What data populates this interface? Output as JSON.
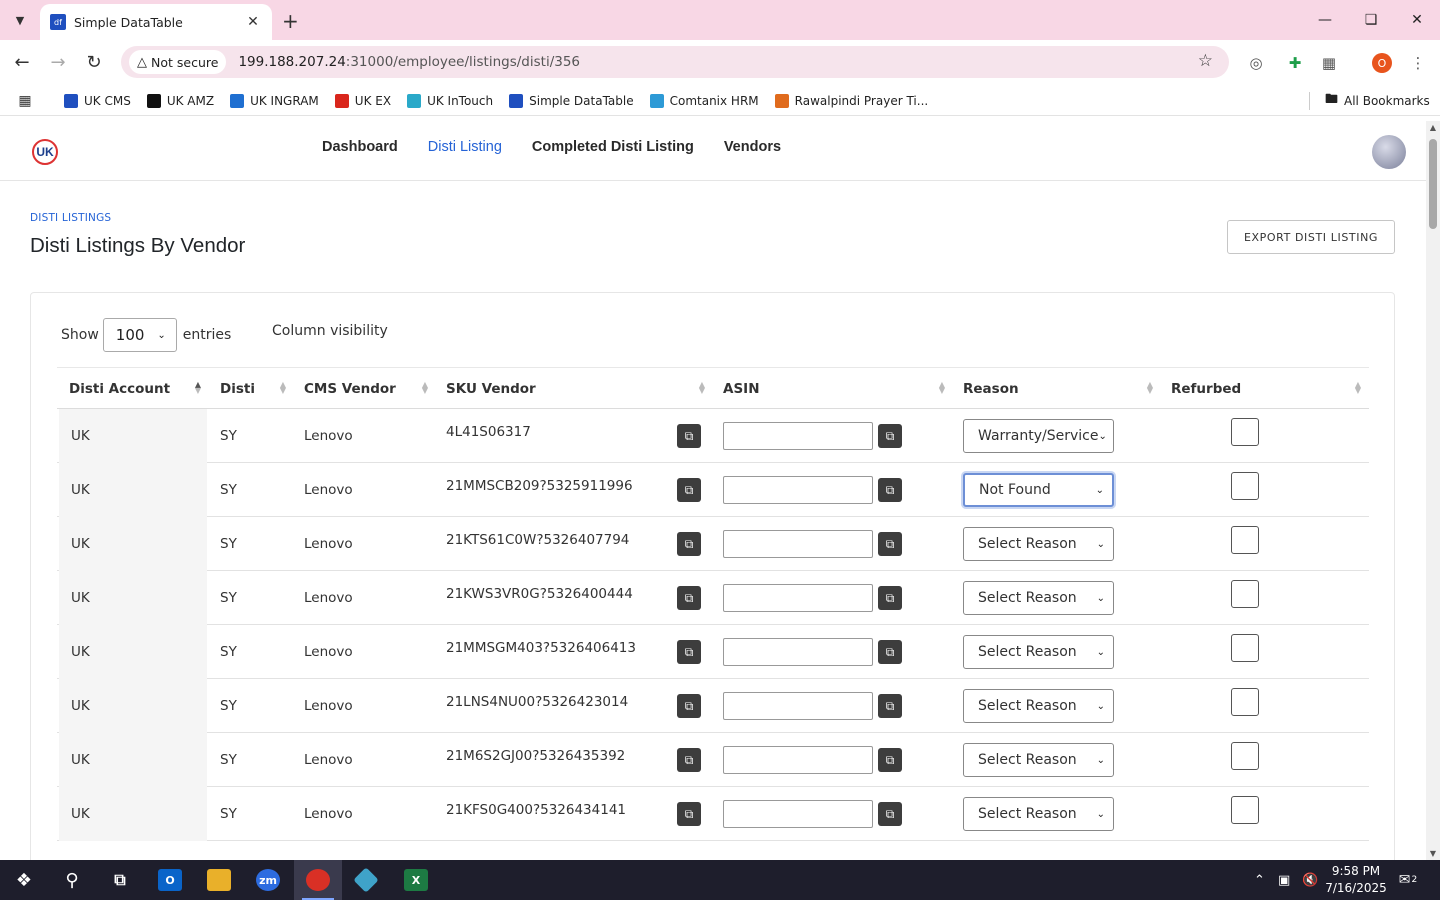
{
  "browser": {
    "tab_title": "Simple DataTable",
    "tab_favicon_text": "df",
    "security_label": "Not secure",
    "url_host": "199.188.207.24",
    "url_rest": ":31000/employee/listings/disti/356",
    "profile_initial": "O",
    "bookmarks": [
      {
        "label": "UK CMS",
        "color": "#1f4fbf"
      },
      {
        "label": "UK AMZ",
        "color": "#111111"
      },
      {
        "label": "UK INGRAM",
        "color": "#1f6fd1"
      },
      {
        "label": "UK EX",
        "color": "#d9261c"
      },
      {
        "label": "UK InTouch",
        "color": "#2aa9c9"
      },
      {
        "label": "Simple DataTable",
        "color": "#1f4fbf"
      },
      {
        "label": "Comtanix HRM",
        "color": "#2d9ad6"
      },
      {
        "label": "Rawalpindi Prayer Ti...",
        "color": "#e06b1d"
      }
    ],
    "all_bookmarks": "All Bookmarks"
  },
  "app": {
    "logo_text": "UK",
    "nav": [
      "Dashboard",
      "Disti Listing",
      "Completed Disti Listing",
      "Vendors"
    ],
    "active_nav": "Disti Listing"
  },
  "page": {
    "overline": "DISTI LISTINGS",
    "title": "Disti Listings By Vendor",
    "export_label": "EXPORT DISTI LISTING",
    "show_label": "Show",
    "entries_value": "100",
    "entries_label": "entries",
    "column_visibility": "Column visibility"
  },
  "table": {
    "headers": [
      "Disti Account",
      "Disti",
      "CMS Vendor",
      "SKU Vendor",
      "ASIN",
      "Reason",
      "Refurbed"
    ],
    "rows": [
      {
        "account": "UK",
        "disti": "SY",
        "vendor": "Lenovo",
        "sku": "4L41S06317",
        "asin": "",
        "reason": "Warranty/Service",
        "refurbed": false
      },
      {
        "account": "UK",
        "disti": "SY",
        "vendor": "Lenovo",
        "sku": "21MMSCB209?5325911996",
        "asin": "",
        "reason": "Not Found",
        "refurbed": false
      },
      {
        "account": "UK",
        "disti": "SY",
        "vendor": "Lenovo",
        "sku": "21KTS61C0W?5326407794",
        "asin": "",
        "reason": "Select Reason",
        "refurbed": false
      },
      {
        "account": "UK",
        "disti": "SY",
        "vendor": "Lenovo",
        "sku": "21KWS3VR0G?5326400444",
        "asin": "",
        "reason": "Select Reason",
        "refurbed": false
      },
      {
        "account": "UK",
        "disti": "SY",
        "vendor": "Lenovo",
        "sku": "21MMSGM403?5326406413",
        "asin": "",
        "reason": "Select Reason",
        "refurbed": false
      },
      {
        "account": "UK",
        "disti": "SY",
        "vendor": "Lenovo",
        "sku": "21LNS4NU00?5326423014",
        "asin": "",
        "reason": "Select Reason",
        "refurbed": false
      },
      {
        "account": "UK",
        "disti": "SY",
        "vendor": "Lenovo",
        "sku": "21M6S2GJ00?5326435392",
        "asin": "",
        "reason": "Select Reason",
        "refurbed": false
      },
      {
        "account": "UK",
        "disti": "SY",
        "vendor": "Lenovo",
        "sku": "21KFS0G400?5326434141",
        "asin": "",
        "reason": "Select Reason",
        "refurbed": false
      }
    ]
  },
  "taskbar": {
    "time": "9:58 PM",
    "date": "7/16/2025",
    "notifications": "2"
  }
}
